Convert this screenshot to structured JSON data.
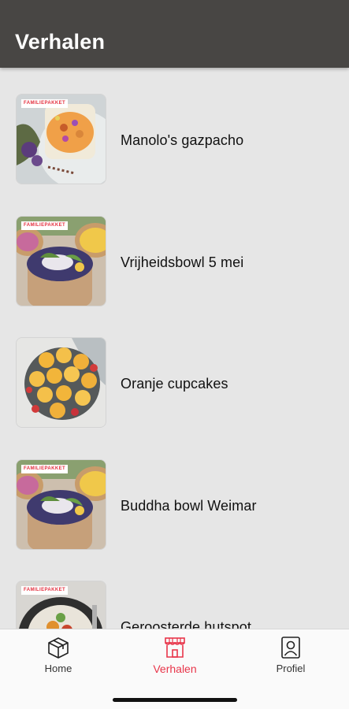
{
  "header": {
    "title": "Verhalen"
  },
  "stories": [
    {
      "title": "Manolo's gazpacho",
      "badge": "FAMILIEPAKKET"
    },
    {
      "title": "Vrijheidsbowl 5 mei",
      "badge": "FAMILIEPAKKET"
    },
    {
      "title": "Oranje cupcakes",
      "badge": ""
    },
    {
      "title": "Buddha bowl Weimar",
      "badge": "FAMILIEPAKKET"
    },
    {
      "title": "Geroosterde hutspot",
      "badge": "FAMILIEPAKKET"
    }
  ],
  "bottom_nav": {
    "items": [
      {
        "label": "Home",
        "icon": "box-icon",
        "active": false
      },
      {
        "label": "Verhalen",
        "icon": "store-icon",
        "active": true
      },
      {
        "label": "Profiel",
        "icon": "profile-icon",
        "active": false
      }
    ],
    "active_color": "#e8354a"
  },
  "colors": {
    "app_bar": "#484644",
    "background": "#e6e6e6"
  }
}
